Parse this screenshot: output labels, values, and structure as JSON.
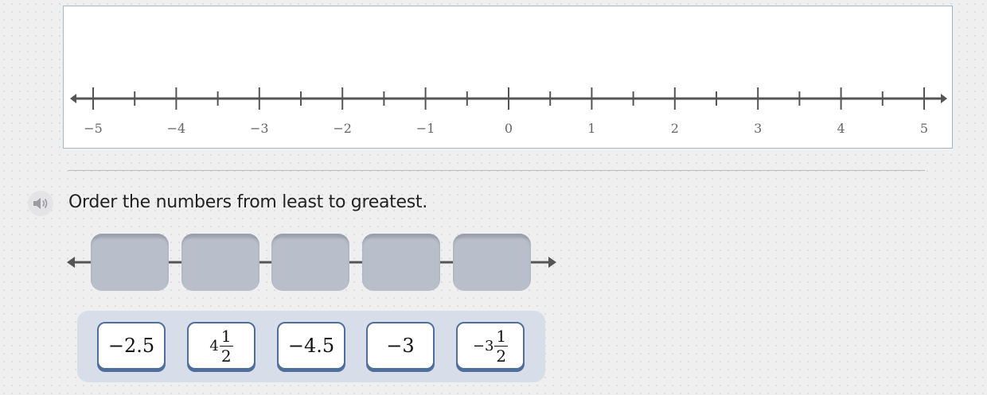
{
  "number_line": {
    "labels": [
      "−5",
      "−4",
      "−3",
      "−2",
      "−1",
      "0",
      "1",
      "2",
      "3",
      "4",
      "5"
    ],
    "min": -5,
    "max": 5,
    "major_step": 1,
    "minor_step": 0.5
  },
  "question": {
    "text": "Order the numbers from least to greatest."
  },
  "answer_slots": [
    {
      "value": ""
    },
    {
      "value": ""
    },
    {
      "value": ""
    },
    {
      "value": ""
    },
    {
      "value": ""
    }
  ],
  "cards": [
    {
      "text": "−2.5"
    },
    {
      "whole": "4",
      "numerator": "1",
      "denominator": "2"
    },
    {
      "text": "−4.5"
    },
    {
      "text": "−3"
    },
    {
      "whole": "−3",
      "numerator": "1",
      "denominator": "2"
    }
  ],
  "icons": {
    "speaker": "speaker-icon"
  },
  "colors": {
    "card_border": "#4f6e9c",
    "slot_fill": "#b8bfcb",
    "panel_border": "#9fb8cc"
  }
}
